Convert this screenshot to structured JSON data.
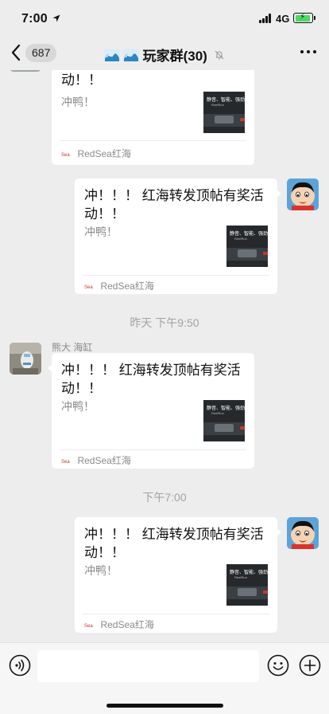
{
  "status_bar": {
    "time": "7:00",
    "network": "4G"
  },
  "nav": {
    "badge_count": "687",
    "title": "玩家群(30)"
  },
  "card": {
    "title": "冲！！！ 红海转发顶帖有奖活动！！",
    "desc": "冲鸭！",
    "source": "RedSea红海",
    "thumb_line1": "静音、智能、强劲",
    "thumb_line2": "ReefRun",
    "thumb_accent": "#c0392b"
  },
  "timestamps": {
    "t1": "昨天 下午9:50",
    "t2": "下午7:00"
  },
  "messages": {
    "received_sender": "熊大 海缸"
  },
  "input_bar": {
    "placeholder": ""
  },
  "colors": {
    "background": "#ededed",
    "bubble": "#ffffff",
    "meta": "#8a8a8a"
  }
}
